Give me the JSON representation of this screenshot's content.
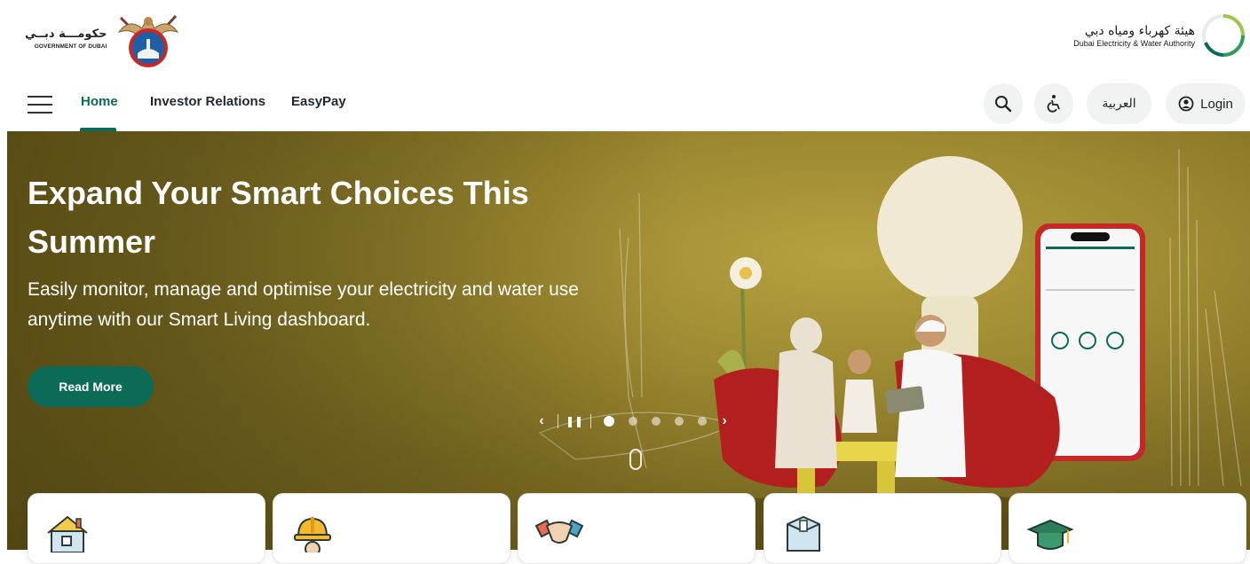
{
  "header": {
    "gov_logo": {
      "arabic": "حكومـــة دبــي",
      "english": "GOVERNMENT OF DUBAI"
    },
    "dewa_logo": {
      "arabic": "هيئة كهرباء ومياه دبي",
      "english": "Dubai Electricity & Water Authority"
    }
  },
  "nav": {
    "links": [
      {
        "label": "Home"
      },
      {
        "label": "Investor Relations"
      },
      {
        "label": "EasyPay"
      }
    ],
    "language_label": "العربية",
    "login_label": "Login"
  },
  "hero": {
    "title": "Expand Your Smart Choices This Summer",
    "subtitle": "Easily monitor, manage and optimise your electricity and water use anytime with our Smart Living dashboard.",
    "cta_label": "Read More",
    "slides_count": 5,
    "active_slide": 1
  },
  "service_cards": [
    {
      "icon": "house-icon"
    },
    {
      "icon": "worker-helmet-icon"
    },
    {
      "icon": "handshake-icon"
    },
    {
      "icon": "package-box-icon"
    },
    {
      "icon": "graduation-cap-icon"
    }
  ],
  "colors": {
    "brand_green": "#0b6b57",
    "hero_gold": "#9b8830"
  }
}
